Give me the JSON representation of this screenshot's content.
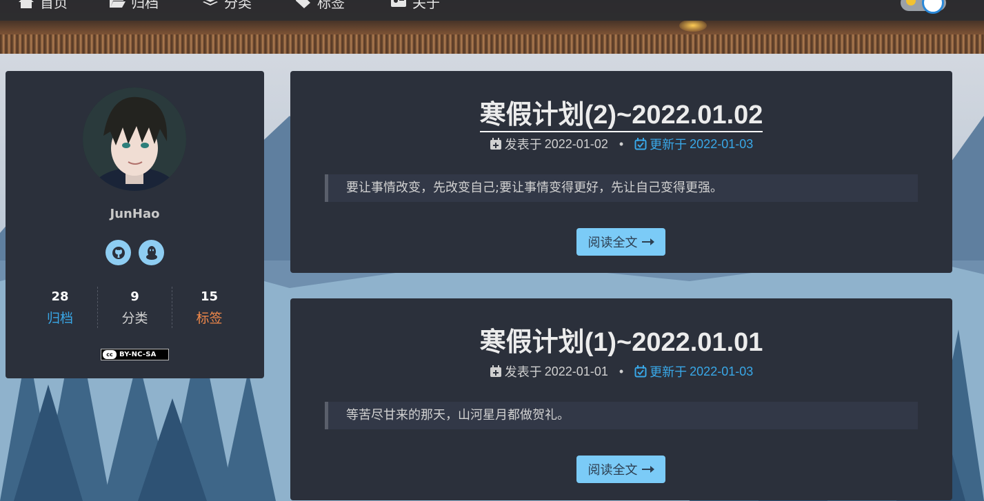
{
  "nav": {
    "items": [
      {
        "label": "首页",
        "icon": "home-icon"
      },
      {
        "label": "归档",
        "icon": "folder-open-icon"
      },
      {
        "label": "分类",
        "icon": "layers-icon"
      },
      {
        "label": "标签",
        "icon": "tags-icon"
      },
      {
        "label": "关于",
        "icon": "id-card-icon"
      }
    ]
  },
  "profile": {
    "name": "JunHao",
    "social": [
      {
        "icon": "github-icon"
      },
      {
        "icon": "qq-icon"
      }
    ],
    "stats": [
      {
        "count": "28",
        "label": "归档",
        "color": "#39a8e8"
      },
      {
        "count": "9",
        "label": "分类",
        "color": "#d0d0d0"
      },
      {
        "count": "15",
        "label": "标签",
        "color": "#f0884a"
      }
    ],
    "license": "BY-NC-SA",
    "license_cc": "cc"
  },
  "posts": [
    {
      "title": "寒假计划(2)~2022.01.02",
      "published_label": "发表于",
      "published_date": "2022-01-02",
      "updated_label": "更新于",
      "updated_date": "2022-01-03",
      "excerpt": "要让事情改变，先改变自己;要让事情变得更好，先让自己变得更强。",
      "read_more": "阅读全文"
    },
    {
      "title": "寒假计划(1)~2022.01.01",
      "published_label": "发表于",
      "published_date": "2022-01-01",
      "updated_label": "更新于",
      "updated_date": "2022-01-03",
      "excerpt": "等苦尽甘来的那天，山河星月都做贺礼。",
      "read_more": "阅读全文"
    }
  ],
  "colors": {
    "card_bg": "#2b303b",
    "accent_blue": "#39a8e8",
    "button_bg": "#7bcbf7",
    "tag_orange": "#f0884a"
  }
}
